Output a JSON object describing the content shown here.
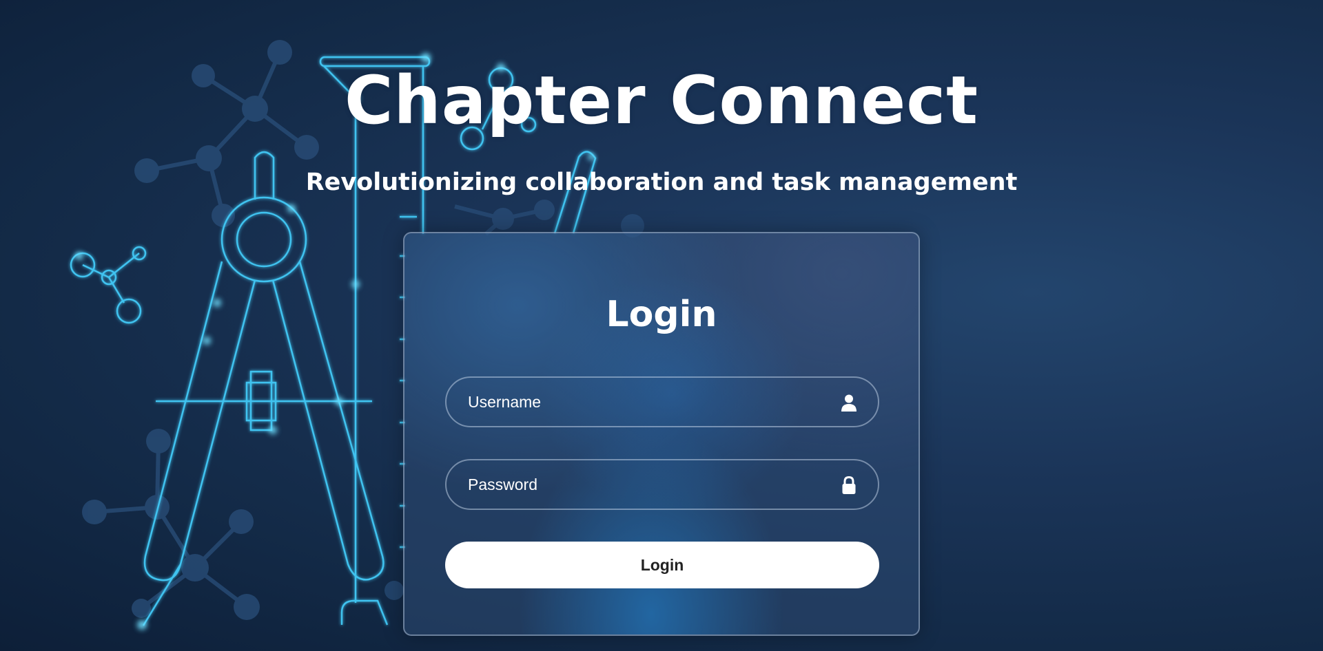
{
  "header": {
    "title": "Chapter Connect",
    "subtitle": "Revolutionizing collaboration and task management"
  },
  "login": {
    "heading": "Login",
    "username": {
      "placeholder": "Username",
      "value": "",
      "icon": "user-icon"
    },
    "password": {
      "placeholder": "Password",
      "value": "",
      "icon": "lock-icon"
    },
    "submit_label": "Login"
  },
  "background": {
    "illustration": "drafting-compass-and-ruler-with-molecules-icon"
  },
  "colors": {
    "background": "#132a47",
    "line_glow": "#3fc3f0",
    "card": "#2d4b73",
    "button": "#ffffff",
    "text": "#ffffff"
  }
}
